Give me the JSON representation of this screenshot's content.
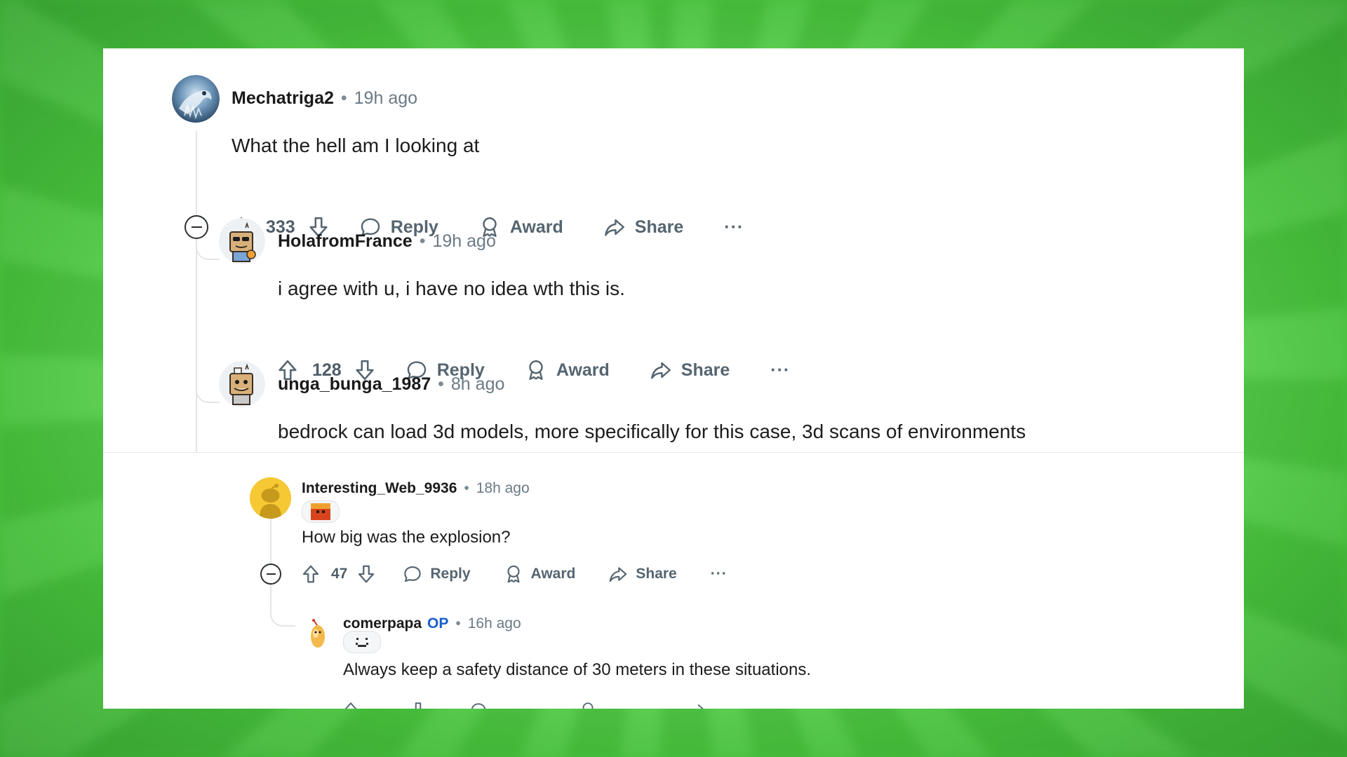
{
  "comments": [
    {
      "user": "Mechatriga2",
      "time": "19h ago",
      "body": "What the hell am I looking at",
      "votes": "333",
      "reply": "Reply",
      "award": "Award",
      "share": "Share",
      "more": "···"
    },
    {
      "user": "HolafromFrance",
      "time": "19h ago",
      "body": "i agree with u, i have no idea wth this is.",
      "votes": "128",
      "reply": "Reply",
      "award": "Award",
      "share": "Share",
      "more": "···"
    },
    {
      "user": "unga_bunga_1987",
      "time": "8h ago",
      "body": "bedrock can load 3d models, more specifically for this case, 3d scans of environments"
    },
    {
      "user": "Interesting_Web_9936",
      "time": "18h ago",
      "body": "How big was the explosion?",
      "votes": "47",
      "reply": "Reply",
      "award": "Award",
      "share": "Share",
      "more": "···"
    },
    {
      "user": "comerpapa",
      "badge": "OP",
      "time": "16h ago",
      "body": "Always keep a safety distance of 30 meters in these situations."
    }
  ],
  "separator": "•",
  "colors": {
    "background_green": "#6fe163",
    "card": "#ffffff",
    "op_badge": "#1a5fcc",
    "muted_text": "#6b7a85"
  }
}
